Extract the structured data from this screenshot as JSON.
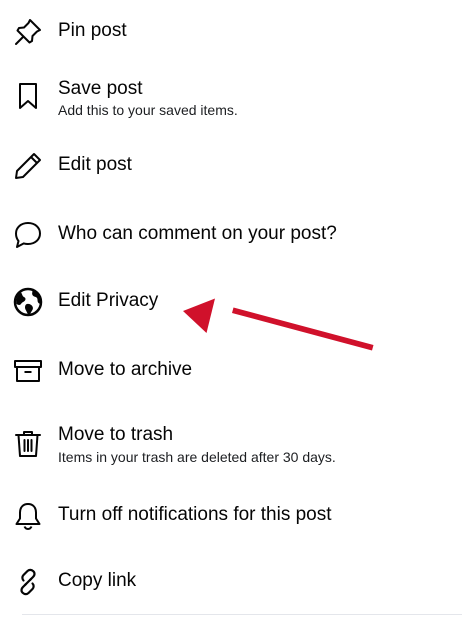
{
  "menu": {
    "items": [
      {
        "title": "Pin post",
        "icon": "pin-icon"
      },
      {
        "title": "Save post",
        "subtitle": "Add this to your saved items.",
        "icon": "bookmark-icon"
      },
      {
        "title": "Edit post",
        "icon": "pencil-icon"
      },
      {
        "title": "Who can comment on your post?",
        "icon": "comment-bubble-icon"
      },
      {
        "title": "Edit Privacy",
        "icon": "globe-icon"
      },
      {
        "title": "Move to archive",
        "icon": "archive-box-icon"
      },
      {
        "title": "Move to trash",
        "subtitle": "Items in your trash are deleted after 30 days.",
        "icon": "trash-can-icon"
      },
      {
        "title": "Turn off notifications for this post",
        "icon": "bell-icon"
      },
      {
        "title": "Copy link",
        "icon": "link-icon"
      }
    ]
  },
  "annotation": {
    "arrow_color": "#d0112b"
  },
  "colors": {
    "text": "#050505",
    "divider": "#e4e6eb"
  }
}
